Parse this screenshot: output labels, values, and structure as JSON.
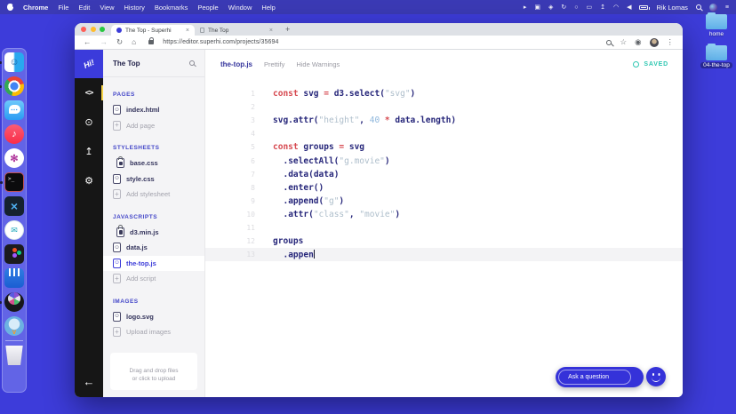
{
  "menubar": {
    "items": [
      "Chrome",
      "File",
      "Edit",
      "View",
      "History",
      "Bookmarks",
      "People",
      "Window",
      "Help"
    ],
    "status_icons": [
      {
        "name": "cursor-icon",
        "glyph": "▸"
      },
      {
        "name": "display-mirror-icon",
        "glyph": "▣"
      },
      {
        "name": "shield-icon",
        "glyph": "◈"
      },
      {
        "name": "sync-icon",
        "glyph": "↻"
      },
      {
        "name": "status-circle-icon",
        "glyph": "○"
      },
      {
        "name": "screen-icon",
        "glyph": "▭"
      },
      {
        "name": "upload-arrow-icon",
        "glyph": "↥"
      },
      {
        "name": "wifi-icon",
        "glyph": "◠"
      },
      {
        "name": "volume-icon",
        "glyph": "◀"
      },
      {
        "name": "battery-icon",
        "glyph": "",
        "css": "batt"
      }
    ],
    "user": "Rik Lomas",
    "trailing_icons": [
      {
        "name": "spotlight-search-icon",
        "glyph": "",
        "css": "search-ic-w"
      },
      {
        "name": "siri-icon",
        "glyph": "",
        "css": "siri"
      },
      {
        "name": "notification-center-icon",
        "glyph": "≡"
      }
    ]
  },
  "dock": {
    "items": [
      {
        "name": "finder",
        "running": true
      },
      {
        "name": "chrome",
        "running": true
      },
      {
        "name": "messages",
        "running": false
      },
      {
        "name": "music",
        "running": false
      },
      {
        "name": "slack",
        "running": false
      },
      {
        "name": "terminal",
        "running": true
      },
      {
        "name": "vscode",
        "running": false
      },
      {
        "name": "airmail",
        "running": false
      },
      {
        "name": "figma",
        "running": false
      },
      {
        "name": "intercom",
        "running": false
      },
      {
        "name": "reel",
        "running": true
      },
      {
        "name": "twitterrific",
        "running": false
      },
      {
        "name": "trash",
        "running": false,
        "divider_before": true
      }
    ]
  },
  "desktop_icons": [
    {
      "label": "home",
      "selected": false
    },
    {
      "label": "04-the-top",
      "selected": true
    }
  ],
  "browser": {
    "tabs": [
      {
        "title": "The Top - Superhi",
        "active": true
      },
      {
        "title": "The Top",
        "active": false
      }
    ],
    "tab_close": "×",
    "new_tab": "+",
    "nav_icons": [
      {
        "name": "back-icon",
        "glyph": "←",
        "disabled": false
      },
      {
        "name": "forward-icon",
        "glyph": "→",
        "disabled": true
      },
      {
        "name": "reload-icon",
        "glyph": "↻",
        "disabled": false
      },
      {
        "name": "home-icon",
        "glyph": "⌂",
        "disabled": false
      }
    ],
    "url": "https://editor.superhi.com/projects/35694",
    "right_icons": [
      {
        "name": "zoom-icon",
        "glyph": "",
        "css": "search-ic-g"
      },
      {
        "name": "bookmark-star-icon",
        "glyph": "☆"
      },
      {
        "name": "profile-icon",
        "glyph": "◉"
      }
    ],
    "menu_dots": "⋮"
  },
  "editor": {
    "nav": {
      "logo_text": "Hi!",
      "icons": [
        {
          "name": "code-editor-icon",
          "glyph": "<>",
          "active": true
        },
        {
          "name": "preview-eye-icon",
          "glyph": "⊙",
          "active": false
        },
        {
          "name": "share-upload-icon",
          "glyph": "↥",
          "active": false
        },
        {
          "name": "settings-gear-icon",
          "glyph": "⚙",
          "active": false
        }
      ],
      "back_arrow": "←"
    },
    "sidebar": {
      "title": "The Top",
      "sections": [
        {
          "header": "PAGES",
          "items": [
            {
              "label": "index.html",
              "icon": "smile",
              "muted": false,
              "selected": false
            },
            {
              "label": "Add page",
              "icon": "plus",
              "muted": true,
              "selected": false
            }
          ]
        },
        {
          "header": "STYLESHEETS",
          "items": [
            {
              "label": "base.css",
              "icon": "lock",
              "muted": false,
              "selected": false
            },
            {
              "label": "style.css",
              "icon": "smile",
              "muted": false,
              "selected": false
            },
            {
              "label": "Add stylesheet",
              "icon": "plus",
              "muted": true,
              "selected": false
            }
          ]
        },
        {
          "header": "JAVASCRIPTS",
          "items": [
            {
              "label": "d3.min.js",
              "icon": "lock",
              "muted": false,
              "selected": false
            },
            {
              "label": "data.js",
              "icon": "smile",
              "muted": false,
              "selected": false
            },
            {
              "label": "the-top.js",
              "icon": "smile",
              "muted": false,
              "selected": true
            },
            {
              "label": "Add script",
              "icon": "plus",
              "muted": true,
              "selected": false
            }
          ]
        },
        {
          "header": "IMAGES",
          "items": [
            {
              "label": "logo.svg",
              "icon": "smile",
              "muted": false,
              "selected": false
            },
            {
              "label": "Upload images",
              "icon": "plus",
              "muted": true,
              "selected": false
            }
          ]
        }
      ],
      "dropzone_line1": "Drag and drop files",
      "dropzone_line2": "or click to upload"
    },
    "toolbar": {
      "filename": "the-top.js",
      "actions": [
        "Prettify",
        "Hide Warnings"
      ],
      "saved": "SAVED"
    },
    "code": {
      "lines": [
        {
          "n": 1,
          "tokens": [
            [
              "kw",
              "const"
            ],
            [
              "pl",
              " "
            ],
            [
              "id",
              "svg"
            ],
            [
              "op",
              " = "
            ],
            [
              "id",
              "d3"
            ],
            [
              "pn",
              "."
            ],
            [
              "id",
              "select"
            ],
            [
              "pn",
              "("
            ],
            [
              "str",
              "\"svg\""
            ],
            [
              "pn",
              ")"
            ]
          ]
        },
        {
          "n": 2,
          "tokens": []
        },
        {
          "n": 3,
          "tokens": [
            [
              "id",
              "svg"
            ],
            [
              "pn",
              "."
            ],
            [
              "id",
              "attr"
            ],
            [
              "pn",
              "("
            ],
            [
              "str",
              "\"height\""
            ],
            [
              "pn",
              ", "
            ],
            [
              "num",
              "40"
            ],
            [
              "op",
              " * "
            ],
            [
              "id",
              "data"
            ],
            [
              "pn",
              "."
            ],
            [
              "id",
              "length"
            ],
            [
              "pn",
              ")"
            ]
          ]
        },
        {
          "n": 4,
          "tokens": []
        },
        {
          "n": 5,
          "tokens": [
            [
              "kw",
              "const"
            ],
            [
              "pl",
              " "
            ],
            [
              "id",
              "groups"
            ],
            [
              "op",
              " = "
            ],
            [
              "id",
              "svg"
            ]
          ]
        },
        {
          "n": 6,
          "tokens": [
            [
              "pl",
              "  "
            ],
            [
              "pn",
              "."
            ],
            [
              "id",
              "selectAll"
            ],
            [
              "pn",
              "("
            ],
            [
              "str",
              "\"g.movie\""
            ],
            [
              "pn",
              ")"
            ]
          ]
        },
        {
          "n": 7,
          "tokens": [
            [
              "pl",
              "  "
            ],
            [
              "pn",
              "."
            ],
            [
              "id",
              "data"
            ],
            [
              "pn",
              "("
            ],
            [
              "id",
              "data"
            ],
            [
              "pn",
              ")"
            ]
          ]
        },
        {
          "n": 8,
          "tokens": [
            [
              "pl",
              "  "
            ],
            [
              "pn",
              "."
            ],
            [
              "id",
              "enter"
            ],
            [
              "pn",
              "()"
            ]
          ]
        },
        {
          "n": 9,
          "tokens": [
            [
              "pl",
              "  "
            ],
            [
              "pn",
              "."
            ],
            [
              "id",
              "append"
            ],
            [
              "pn",
              "("
            ],
            [
              "str",
              "\"g\""
            ],
            [
              "pn",
              ")"
            ]
          ]
        },
        {
          "n": 10,
          "tokens": [
            [
              "pl",
              "  "
            ],
            [
              "pn",
              "."
            ],
            [
              "id",
              "attr"
            ],
            [
              "pn",
              "("
            ],
            [
              "str",
              "\"class\""
            ],
            [
              "pn",
              ", "
            ],
            [
              "str",
              "\"movie\""
            ],
            [
              "pn",
              ")"
            ]
          ]
        },
        {
          "n": 11,
          "tokens": []
        },
        {
          "n": 12,
          "tokens": [
            [
              "id",
              "groups"
            ]
          ]
        },
        {
          "n": 13,
          "tokens": [
            [
              "pl",
              "  "
            ],
            [
              "pn",
              "."
            ],
            [
              "id",
              "appen"
            ]
          ],
          "cursor": true,
          "current": true
        }
      ]
    },
    "help": {
      "ask_placeholder": "Ask a question"
    }
  },
  "colors": {
    "desktop": "#3d3cda",
    "menubar": "#3b3ab5",
    "accent": "#3b3bd8",
    "saved": "#2fc7b2",
    "active_tab_marker": "#f5d348",
    "keyword": "#d6484f",
    "identifier": "#26267a",
    "string": "#aebecb",
    "number": "#8fb7dc"
  }
}
